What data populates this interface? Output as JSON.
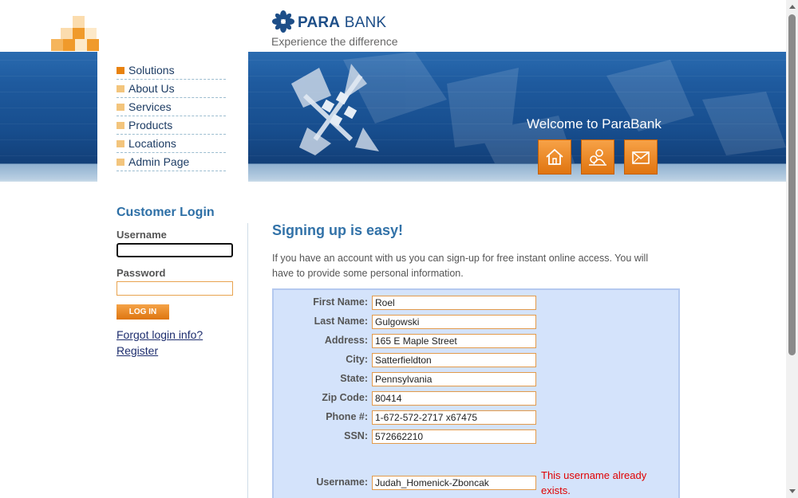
{
  "header": {
    "brand_para": "PARA",
    "brand_bank": "BANK",
    "tagline": "Experience the difference",
    "welcome": "Welcome to ParaBank",
    "buttons": [
      {
        "icon": "home-icon"
      },
      {
        "icon": "about-icon"
      },
      {
        "icon": "contact-icon"
      }
    ]
  },
  "menu": {
    "items": [
      {
        "label": "Solutions",
        "active": true
      },
      {
        "label": "About Us"
      },
      {
        "label": "Services"
      },
      {
        "label": "Products"
      },
      {
        "label": "Locations"
      },
      {
        "label": "Admin Page"
      }
    ]
  },
  "login": {
    "title": "Customer Login",
    "username_label": "Username",
    "password_label": "Password",
    "button": "LOG IN",
    "forgot": "Forgot login info?",
    "register": "Register"
  },
  "main": {
    "title": "Signing up is easy!",
    "intro": "If you have an account with us you can sign-up for free instant online access. You will have to provide some personal information."
  },
  "form": {
    "fields": [
      {
        "label": "First Name:",
        "value": "Roel"
      },
      {
        "label": "Last Name:",
        "value": "Gulgowski"
      },
      {
        "label": "Address:",
        "value": "165 E Maple Street"
      },
      {
        "label": "City:",
        "value": "Satterfieldton"
      },
      {
        "label": "State:",
        "value": "Pennsylvania"
      },
      {
        "label": "Zip Code:",
        "value": "80414"
      },
      {
        "label": "Phone #:",
        "value": "1-672-572-2717 x67475"
      },
      {
        "label": "SSN:",
        "value": "572662210"
      }
    ],
    "username": {
      "label": "Username:",
      "value": "Judah_Homenick-Zboncak",
      "error": "This username already exists."
    }
  },
  "colors": {
    "accent": "#e8820e",
    "brand_blue": "#1d4e88",
    "error": "#e00000",
    "form_bg": "#d4e3fb"
  }
}
